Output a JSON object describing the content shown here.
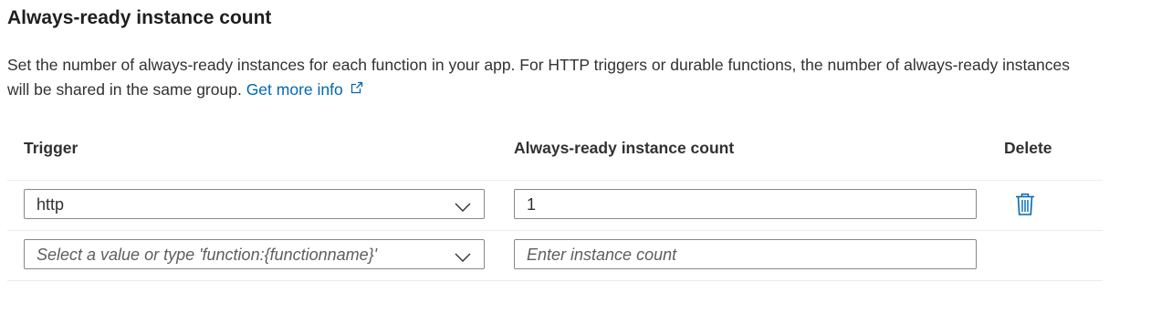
{
  "section": {
    "title": "Always-ready instance count",
    "description": "Set the number of always-ready instances for each function in your app. For HTTP triggers or durable functions, the number of always-ready instances will be shared in the same group.",
    "link_label": "Get more info"
  },
  "table": {
    "headers": {
      "trigger": "Trigger",
      "count": "Always-ready instance count",
      "delete": "Delete"
    },
    "rows": [
      {
        "trigger": "http",
        "count": "1"
      }
    ],
    "new_row": {
      "trigger_placeholder": "Select a value or type 'function:{functionname}'",
      "count_placeholder": "Enter instance count"
    }
  },
  "colors": {
    "link": "#0067b8",
    "border": "#8a8886",
    "divider": "#edebe9"
  },
  "icons": {
    "external_link": "external-link-icon",
    "dropdown": "chevron-down-icon",
    "delete": "trash-icon"
  }
}
